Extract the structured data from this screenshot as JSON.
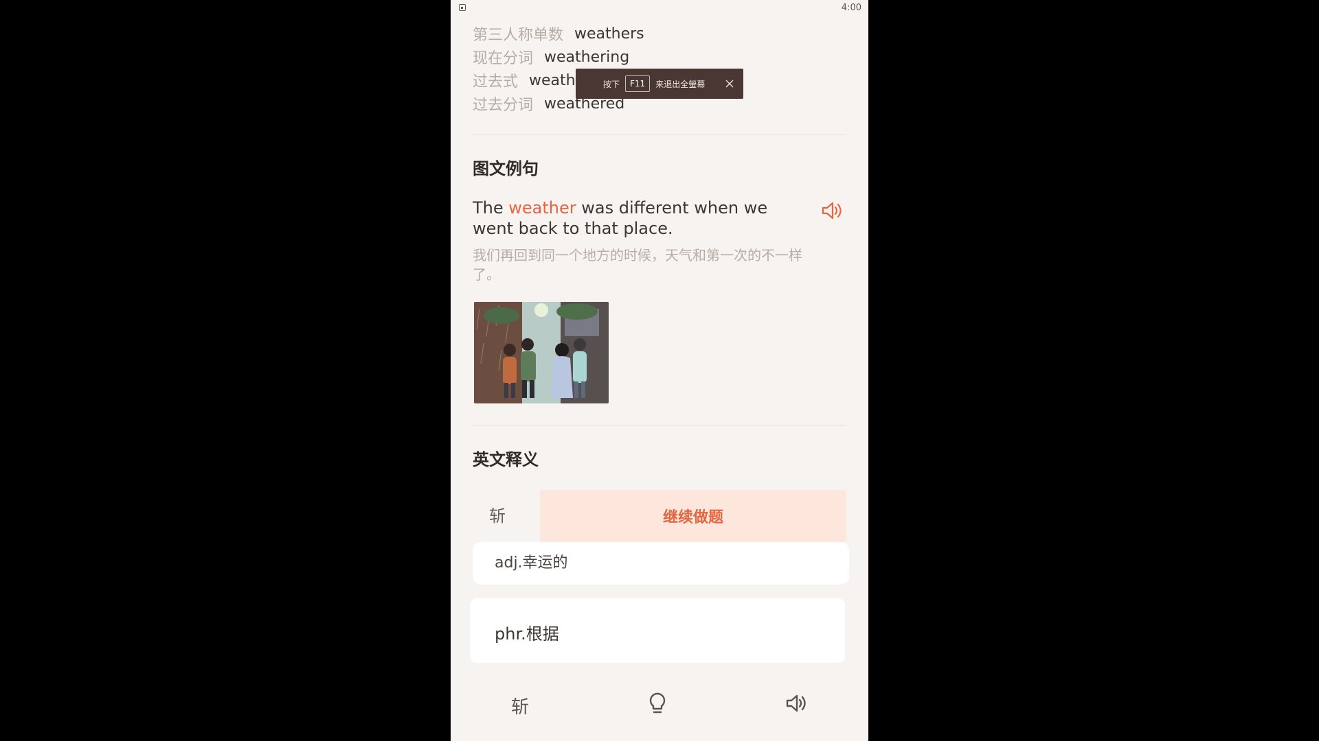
{
  "status_bar": {
    "time": "4:00"
  },
  "word_forms": [
    {
      "label": "第三人称单数",
      "value": "weathers"
    },
    {
      "label": "现在分词",
      "value": "weathering"
    },
    {
      "label": "过去式",
      "value": "weathered"
    },
    {
      "label": "过去分词",
      "value": "weathered"
    }
  ],
  "example_section": {
    "title": "图文例句",
    "sentence_before": "The ",
    "sentence_highlight": "weather",
    "sentence_after": " was different when we went back to that place.",
    "translation": "我们再回到同一个地方的时候，天气和第一次的不一样了。",
    "speaker_icon": "speaker-icon",
    "image_icon": "example-illustration"
  },
  "english_def_section": {
    "title": "英文释义"
  },
  "action_row": {
    "skip_label": "斩",
    "continue_label": "继续做题"
  },
  "definition_card": {
    "text": "adj.幸运的"
  },
  "phrase_card": {
    "text": "phr.根据"
  },
  "bottom_bar": {
    "skip_label": "斩",
    "hint_icon": "lightbulb-icon",
    "sound_icon": "speaker-icon"
  },
  "fullscreen_toast": {
    "prefix": "按下",
    "key": "F11",
    "suffix": "来退出全螢幕",
    "close_icon": "close-icon"
  },
  "colors": {
    "accent": "#e8643e",
    "continue_bg": "#fde7dd",
    "background": "#f7f3f1"
  }
}
